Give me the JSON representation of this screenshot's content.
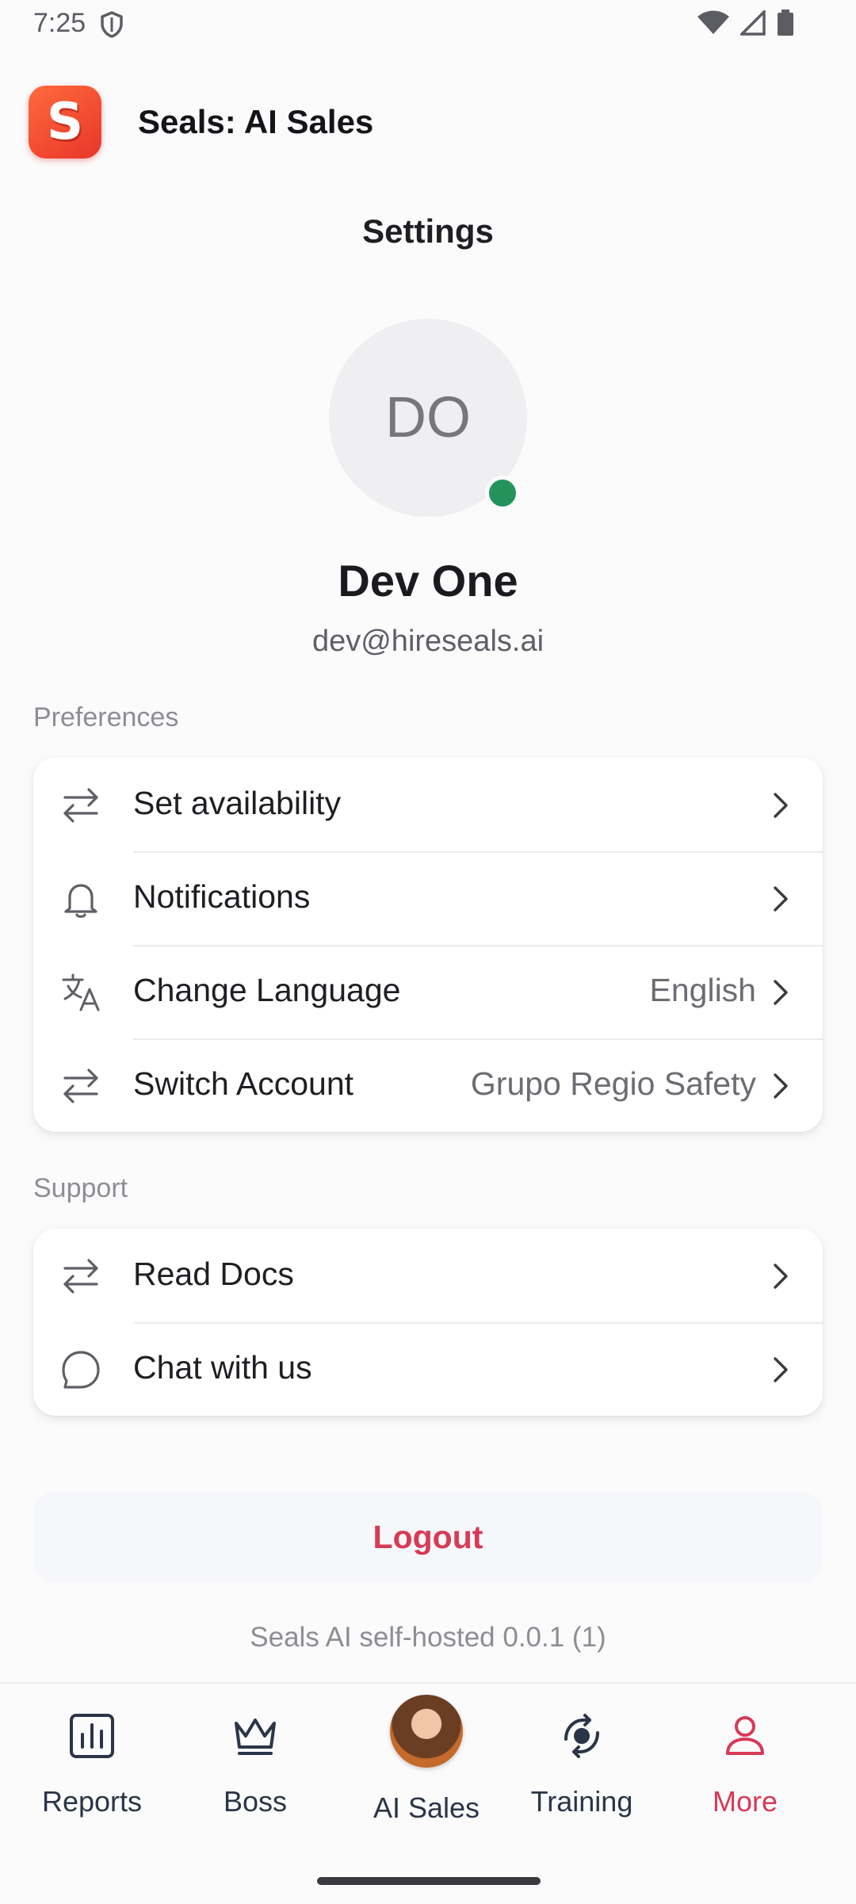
{
  "status_bar": {
    "time": "7:25"
  },
  "app": {
    "logo_letter": "S",
    "title": "Seals: AI Sales"
  },
  "page_title": "Settings",
  "profile": {
    "initials": "DO",
    "name": "Dev One",
    "email": "dev@hireseals.ai",
    "online": true
  },
  "preferences": {
    "label": "Preferences",
    "items": [
      {
        "label": "Set availability",
        "value": "",
        "icon": "swap-arrows-icon"
      },
      {
        "label": "Notifications",
        "value": "",
        "icon": "bell-icon"
      },
      {
        "label": "Change Language",
        "value": "English",
        "icon": "translate-icon"
      },
      {
        "label": "Switch Account",
        "value": "Grupo Regio Safety",
        "icon": "swap-arrows-icon"
      }
    ]
  },
  "support": {
    "label": "Support",
    "items": [
      {
        "label": "Read Docs",
        "icon": "swap-arrows-icon"
      },
      {
        "label": "Chat with us",
        "icon": "chat-bubble-icon"
      }
    ]
  },
  "logout_label": "Logout",
  "version_text": "Seals AI self-hosted 0.0.1 (1)",
  "bottom_nav": {
    "items": [
      {
        "label": "Reports",
        "icon": "bar-chart-icon",
        "active": false
      },
      {
        "label": "Boss",
        "icon": "crown-icon",
        "active": false
      },
      {
        "label": "AI Sales",
        "icon": "agent-avatar",
        "active": false
      },
      {
        "label": "Training",
        "icon": "rotate-brain-icon",
        "active": false
      },
      {
        "label": "More",
        "icon": "person-icon",
        "active": true
      }
    ]
  },
  "colors": {
    "accent": "#D83A56",
    "online": "#24935B",
    "nav_inactive": "#2B3547",
    "logo": "#F04A2F"
  }
}
